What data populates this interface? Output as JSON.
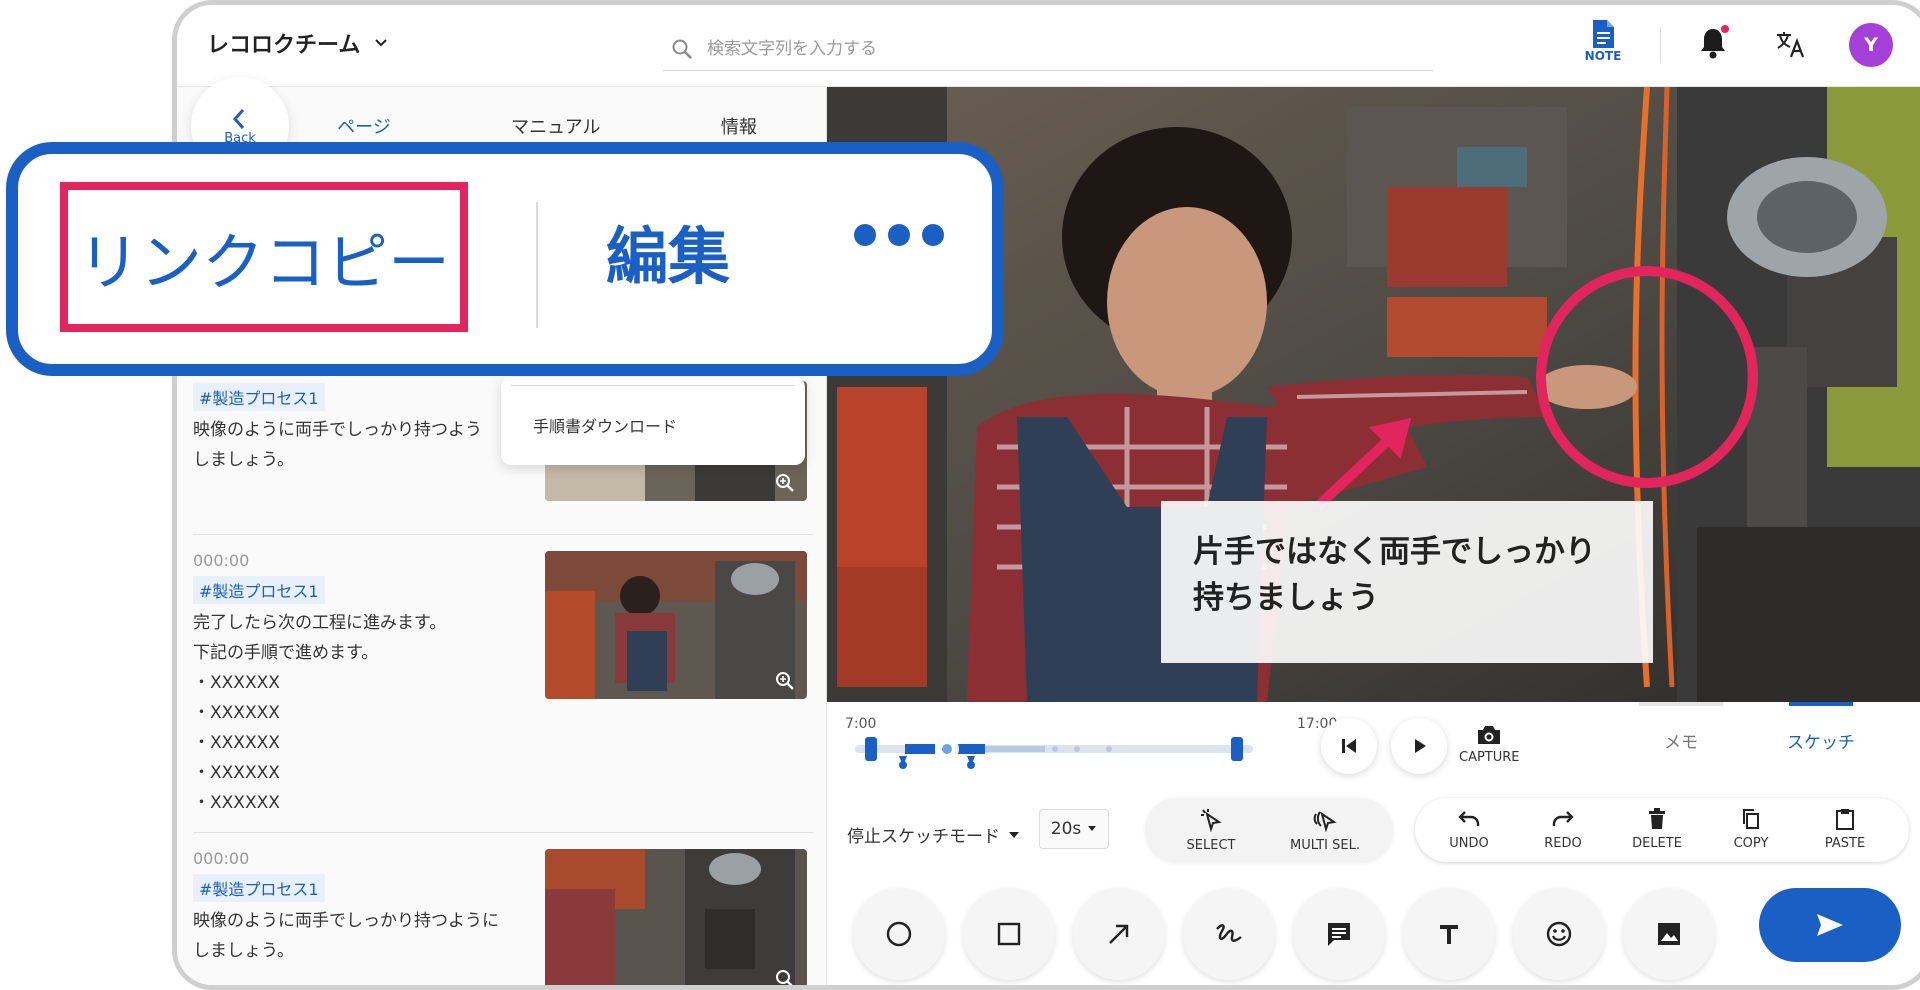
{
  "header": {
    "team_name": "レコロクチーム",
    "search_placeholder": "検索文字列を入力する",
    "note_label": "NOTE",
    "avatar_initial": "Y"
  },
  "left_panel": {
    "back_label": "Back",
    "tabs": [
      "ページ",
      "マニュアル",
      "情報"
    ],
    "active_tab": "ページ",
    "context_menu_item": "手順書ダウンロード",
    "notes": [
      {
        "time": "",
        "tag": "#製造プロセス1",
        "body": "映像のように両手でしっかり持つよう\nしましょう。"
      },
      {
        "time": "000:00",
        "tag": "#製造プロセス1",
        "body": "完了したら次の工程に進みます。\n下記の手順で進めます。\n・XXXXXX\n・XXXXXX\n・XXXXXX\n・XXXXXX\n・XXXXXX"
      },
      {
        "time": "000:00",
        "tag": "#製造プロセス1",
        "body": "映像のように両手でしっかり持つように\nしましょう。"
      }
    ]
  },
  "video": {
    "caption": "片手ではなく両手でしっかり\n持ちましょう"
  },
  "controls": {
    "timeline_start": "7:00",
    "timeline_end": "17:00",
    "capture_label": "CAPTURE",
    "mode_tabs": [
      "メモ",
      "スケッチ"
    ],
    "active_mode": "スケッチ",
    "stop_sketch_mode": "停止スケッチモード",
    "interval": "20s",
    "select_tools": [
      {
        "label": "SELECT",
        "icon": "cursor-click-icon"
      },
      {
        "label": "MULTI SEL.",
        "icon": "multi-cursor-icon"
      }
    ],
    "edit_tools": [
      {
        "label": "UNDO",
        "icon": "undo-icon"
      },
      {
        "label": "REDO",
        "icon": "redo-icon"
      },
      {
        "label": "DELETE",
        "icon": "trash-icon"
      },
      {
        "label": "COPY",
        "icon": "copy-icon"
      },
      {
        "label": "PASTE",
        "icon": "clipboard-icon"
      }
    ],
    "shape_tools": [
      "circle-icon",
      "square-icon",
      "arrow-icon",
      "freehand-icon",
      "comment-icon",
      "text-icon",
      "emoji-icon",
      "image-icon"
    ]
  },
  "callout": {
    "link_copy": "リンクコピー",
    "edit": "編集"
  },
  "colors": {
    "accent": "#1a5fc4",
    "highlight": "#e3255e",
    "avatar": "#a43fd8"
  }
}
